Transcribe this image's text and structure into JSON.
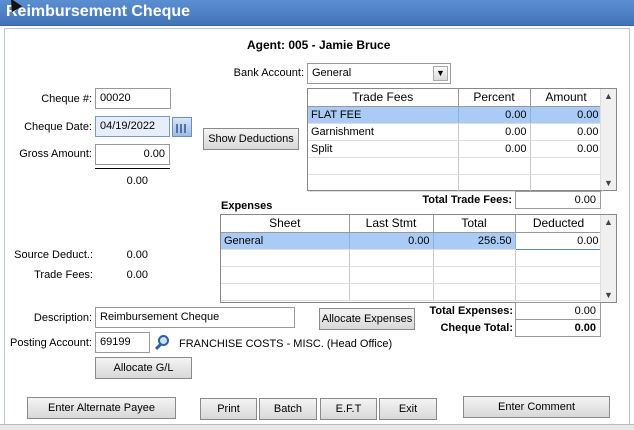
{
  "window": {
    "title": "Reimbursement Cheque"
  },
  "agent": {
    "label": "Agent: 005 - Jamie Bruce"
  },
  "bank_account": {
    "label": "Bank Account:",
    "value": "General"
  },
  "cheque_number": {
    "label": "Cheque #:",
    "value": "00020"
  },
  "cheque_date": {
    "label": "Cheque Date:",
    "value": "04/19/2022"
  },
  "gross_amount": {
    "label": "Gross Amount:",
    "value": "0.00"
  },
  "gross_subtotal": "0.00",
  "show_deductions_button": "Show Deductions",
  "trade_fees_grid": {
    "columns": [
      "Trade Fees",
      "Percent",
      "Amount"
    ],
    "rows": [
      {
        "name": "FLAT FEE",
        "percent": "0.00",
        "amount": "0.00"
      },
      {
        "name": "Garnishment",
        "percent": "0.00",
        "amount": "0.00"
      },
      {
        "name": "Split",
        "percent": "0.00",
        "amount": "0.00"
      }
    ]
  },
  "total_trade_fees": {
    "label": "Total Trade Fees:",
    "value": "0.00"
  },
  "expenses_grid": {
    "title": "Expenses",
    "columns": [
      "Sheet",
      "Last Stmt",
      "Total",
      "Deducted"
    ],
    "rows": [
      {
        "sheet": "General",
        "last_stmt": "0.00",
        "total": "256.50",
        "deducted": "0.00"
      }
    ]
  },
  "source_deduct": {
    "label": "Source Deduct.:",
    "value": "0.00"
  },
  "trade_fees_summary": {
    "label": "Trade Fees:",
    "value": "0.00"
  },
  "description": {
    "label": "Description:",
    "value": "Reimbursement Cheque"
  },
  "allocate_expenses_button": "Allocate Expenses",
  "total_expenses": {
    "label": "Total Expenses:",
    "value": "0.00"
  },
  "cheque_total": {
    "label": "Cheque Total:",
    "value": "0.00"
  },
  "posting_account": {
    "label": "Posting Account:",
    "value": "69199",
    "description": "FRANCHISE COSTS - MISC. (Head Office)"
  },
  "allocate_gl_button": "Allocate G/L",
  "footer_buttons": {
    "enter_alternate_payee": "Enter Alternate Payee",
    "print": "Print",
    "batch": "Batch",
    "eft": "E.F.T",
    "exit": "Exit",
    "enter_comment": "Enter Comment"
  }
}
